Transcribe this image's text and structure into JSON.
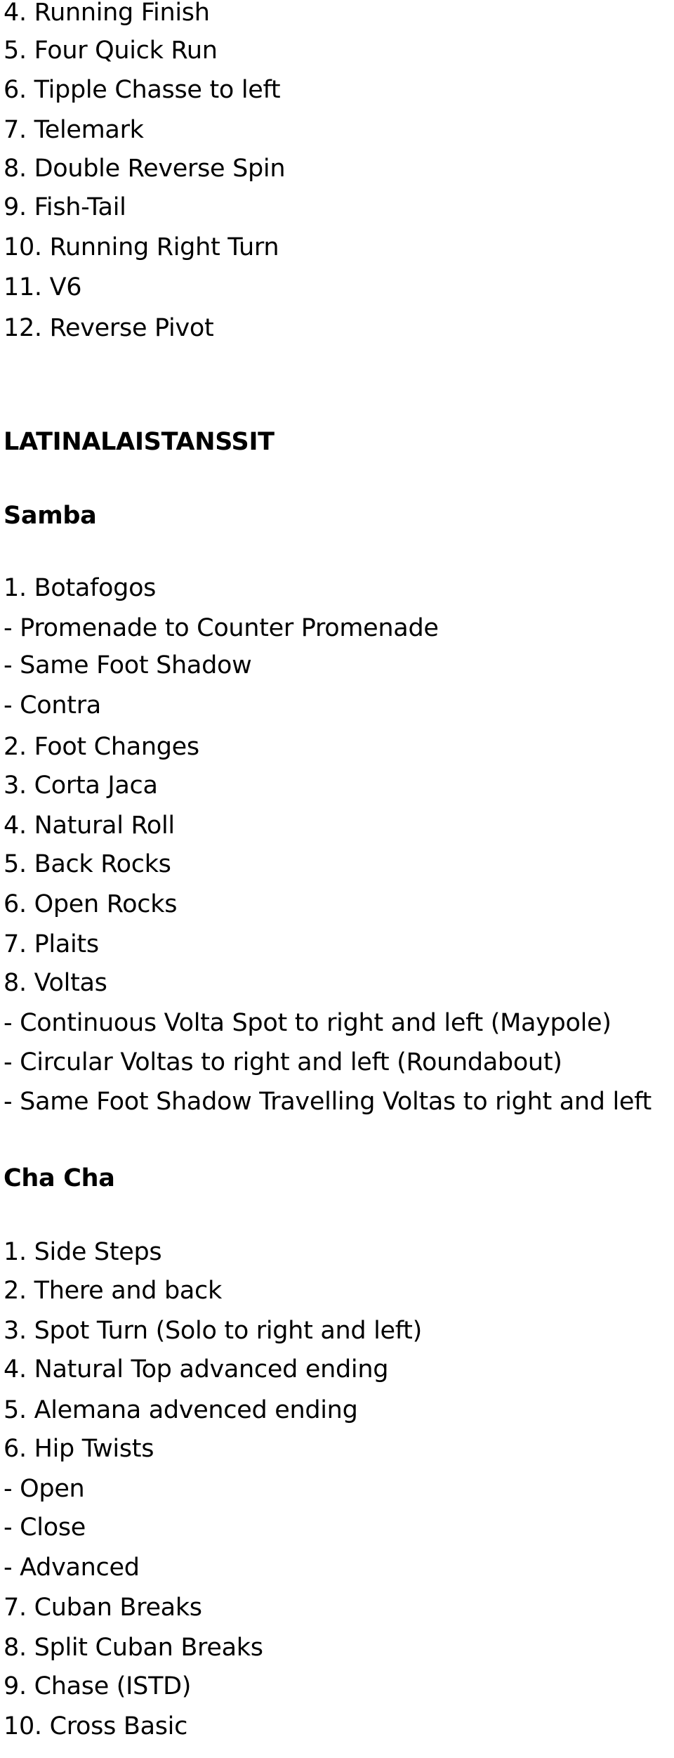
{
  "document": {
    "ballroom_continued": [
      "4. Running Finish",
      "5. Four Quick Run",
      "6. Tipple Chasse to left",
      "7. Telemark",
      "8. Double Reverse Spin",
      "9. Fish-Tail",
      "10. Running Right Turn",
      "11. V6",
      "12. Reverse Pivot"
    ],
    "section_title": "LATINALAISTANSSIT",
    "samba": {
      "title": "Samba",
      "lines": [
        "1. Botafogos",
        "- Promenade to Counter Promenade",
        "- Same Foot Shadow",
        "- Contra",
        "2. Foot Changes",
        "3. Corta Jaca",
        "4. Natural Roll",
        "5. Back Rocks",
        "6. Open Rocks",
        "7. Plaits",
        "8. Voltas",
        "- Continuous Volta Spot to right and left (Maypole)",
        "- Circular Voltas to right and left (Roundabout)",
        "- Same Foot Shadow Travelling Voltas to right and left"
      ]
    },
    "cha_cha": {
      "title": "Cha Cha",
      "lines": [
        "1. Side Steps",
        "2. There and back",
        "3. Spot Turn (Solo to right and left)",
        "4. Natural Top advanced ending",
        "5. Alemana advenced ending",
        "6. Hip Twists",
        "- Open",
        "- Close",
        "- Advanced",
        "7. Cuban Breaks",
        "8. Split Cuban Breaks",
        "9. Chase (ISTD)",
        "10. Cross Basic"
      ]
    }
  }
}
